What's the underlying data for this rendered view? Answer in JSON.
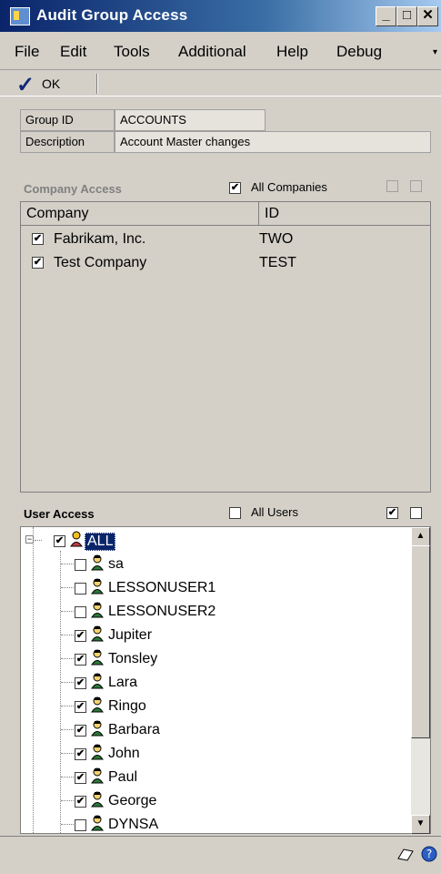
{
  "window": {
    "title": "Audit Group Access"
  },
  "menu": [
    "File",
    "Edit",
    "Tools",
    "Additional",
    "Help",
    "Debug"
  ],
  "toolbar": {
    "ok_label": "OK"
  },
  "header": {
    "group_id_label": "Group ID",
    "group_id_value": "ACCOUNTS",
    "description_label": "Description",
    "description_value": "Account Master changes"
  },
  "company_access": {
    "title": "Company Access",
    "all_companies_label": "All Companies",
    "all_companies_checked": true,
    "columns": [
      "Company",
      "ID"
    ],
    "rows": [
      {
        "name": "Fabrikam, Inc.",
        "id": "TWO",
        "checked": true
      },
      {
        "name": "Test Company",
        "id": "TEST",
        "checked": true
      }
    ]
  },
  "user_access": {
    "title": "User Access",
    "all_users_label": "All Users",
    "all_users_checked": false,
    "root": {
      "label": "ALL",
      "checked": true
    },
    "users": [
      {
        "name": "sa",
        "checked": false
      },
      {
        "name": "LESSONUSER1",
        "checked": false
      },
      {
        "name": "LESSONUSER2",
        "checked": false
      },
      {
        "name": "Jupiter",
        "checked": true
      },
      {
        "name": "Tonsley",
        "checked": true
      },
      {
        "name": "Lara",
        "checked": true
      },
      {
        "name": "Ringo",
        "checked": true
      },
      {
        "name": "Barbara",
        "checked": true
      },
      {
        "name": "John",
        "checked": true
      },
      {
        "name": "Paul",
        "checked": true
      },
      {
        "name": "George",
        "checked": true
      },
      {
        "name": "DYNSA",
        "checked": false
      }
    ]
  },
  "colors": {
    "title_start": "#0a246a",
    "title_end": "#a6caf0",
    "window_bg": "#d4d0c8",
    "selection": "#0a246a"
  }
}
